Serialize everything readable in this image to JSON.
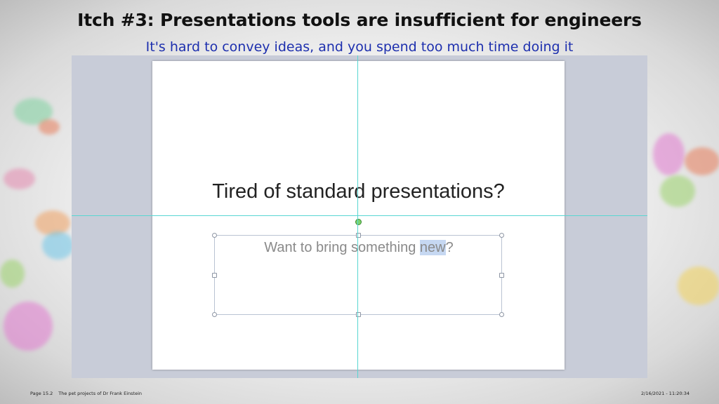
{
  "header": {
    "title": "Itch #3: Presentations tools are insufficient for engineers",
    "subtitle": "It's hard to convey ideas, and you spend too much time doing it"
  },
  "slide": {
    "title": "Tired of standard presentations?",
    "body_before": "Want to bring something ",
    "body_highlight": "new",
    "body_after": "?"
  },
  "footer": {
    "page": "Page 15.2",
    "project": "The pet projects of Dr Frank Einstein",
    "datetime": "2/16/2021 - 11:20:34"
  },
  "colors": {
    "subtitle": "#1d2fae",
    "guides": "#58d6d2",
    "selection_highlight": "#c6d8f2"
  }
}
